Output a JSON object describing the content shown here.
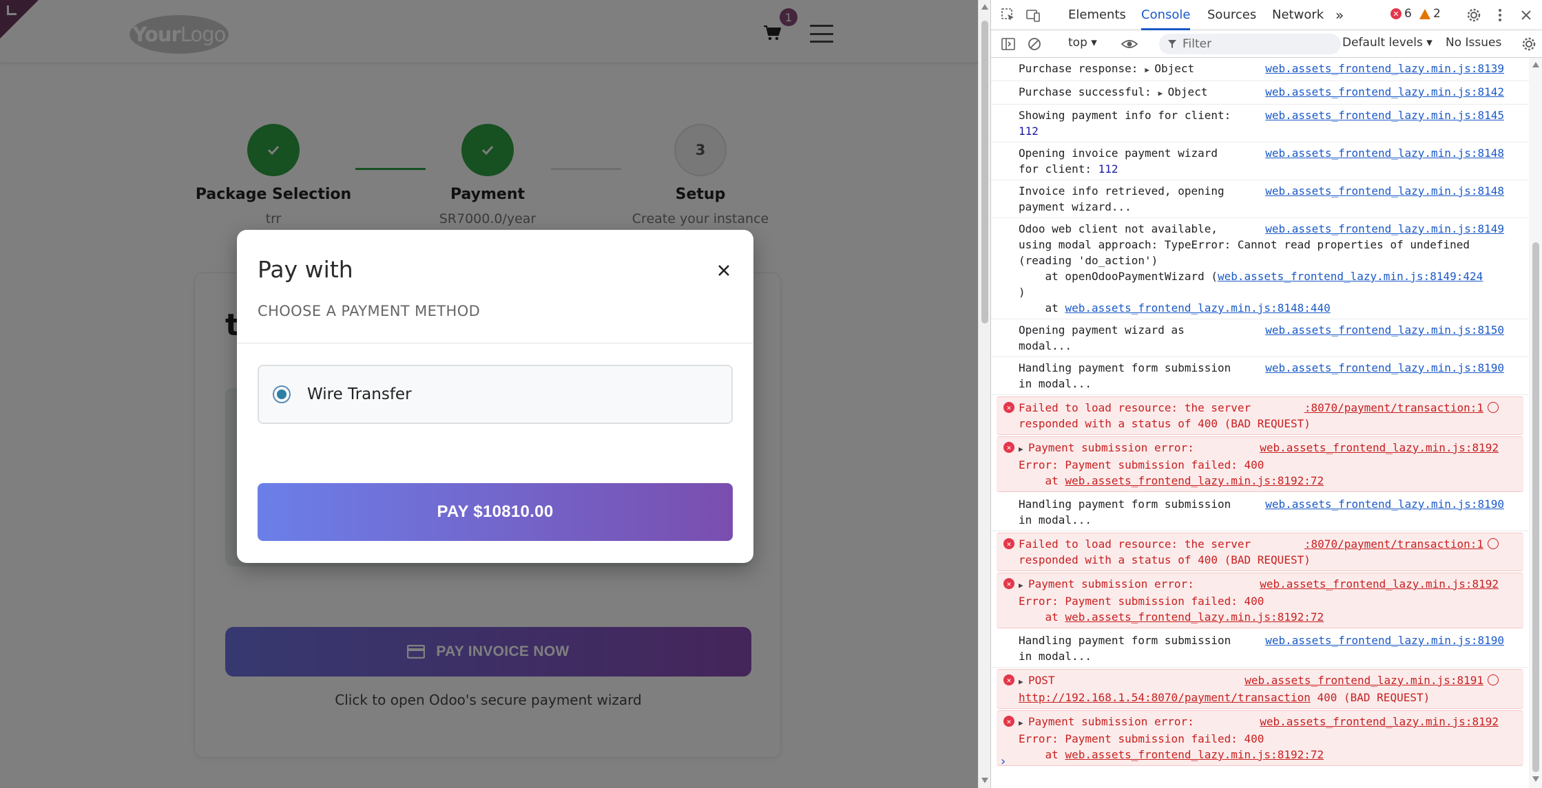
{
  "site": {
    "logo_bold": "Your",
    "logo_thin": "Logo",
    "cart_count": "1"
  },
  "steps": [
    {
      "title": "Package Selection",
      "sub": "trr",
      "state": "done"
    },
    {
      "title": "Payment",
      "sub": "SR7000.0/year",
      "state": "done"
    },
    {
      "title": "Setup",
      "sub": "Create your instance",
      "state": "todo",
      "number": "3"
    }
  ],
  "card": {
    "heading_partial": "t",
    "pay_invoice_label": "PAY INVOICE NOW",
    "hint": "Click to open Odoo's secure payment wizard"
  },
  "modal": {
    "title": "Pay with",
    "subtitle": "CHOOSE A PAYMENT METHOD",
    "method_label": "Wire Transfer",
    "pay_label": "PAY $10810.00"
  },
  "colors": {
    "step_done": "#2ea043",
    "cart_badge": "#8a4b78",
    "error_text": "#c71f1f",
    "link_blue": "#1a59c7"
  },
  "devtools": {
    "tabs": [
      "Elements",
      "Console",
      "Sources",
      "Network"
    ],
    "active_tab": "Console",
    "error_count": "6",
    "warning_count": "2",
    "context": "top",
    "filter_placeholder": "Filter",
    "levels": "Default levels",
    "issues": "No Issues",
    "messages": [
      {
        "type": "log",
        "text": "Purchase response:",
        "obj": "Object",
        "src": "web.assets_frontend_lazy.min.js:8139"
      },
      {
        "type": "log",
        "text": "Purchase successful:",
        "obj": "Object",
        "src": "web.assets_frontend_lazy.min.js:8142"
      },
      {
        "type": "log",
        "text": "Showing payment info for client:",
        "num": "112",
        "src": "web.assets_frontend_lazy.min.js:8145"
      },
      {
        "type": "log",
        "text": "Opening invoice payment wizard",
        "text2": "for client:",
        "num": "112",
        "src": "web.assets_frontend_lazy.min.js:8148"
      },
      {
        "type": "log",
        "text": "Invoice info retrieved, opening",
        "text2": "payment wizard...",
        "src": "web.assets_frontend_lazy.min.js:8148"
      },
      {
        "type": "log",
        "text": "Odoo web client not available,",
        "text2": "using modal approach: TypeError: Cannot read properties of undefined",
        "text3": "(reading 'do_action')",
        "text4": "    at openOdooPaymentWizard (",
        "link4": "web.assets_frontend_lazy.min.js:8149:424",
        "text5": ")",
        "text6": "    at ",
        "link6": "web.assets_frontend_lazy.min.js:8148:440",
        "src": "web.assets_frontend_lazy.min.js:8149"
      },
      {
        "type": "log",
        "text": "Opening payment wizard as",
        "text2": "modal...",
        "src": "web.assets_frontend_lazy.min.js:8150"
      },
      {
        "type": "log",
        "text": "Handling payment form submission",
        "text2": "in modal...",
        "src": "web.assets_frontend_lazy.min.js:8190"
      },
      {
        "type": "error",
        "text": "Failed to load resource: the server",
        "text2": "responded with a status of 400 (BAD REQUEST)",
        "src": ":8070/payment/transaction:1"
      },
      {
        "type": "error",
        "tri": true,
        "text": "Payment submission error:",
        "text2": "Error: Payment submission failed: 400",
        "text3": "    at ",
        "link3": "web.assets_frontend_lazy.min.js:8192:72",
        "src": "web.assets_frontend_lazy.min.js:8192"
      },
      {
        "type": "log",
        "text": "Handling payment form submission",
        "text2": "in modal...",
        "src": "web.assets_frontend_lazy.min.js:8190"
      },
      {
        "type": "error",
        "text": "Failed to load resource: the server",
        "text2": "responded with a status of 400 (BAD REQUEST)",
        "src": ":8070/payment/transaction:1"
      },
      {
        "type": "error",
        "tri": true,
        "text": "Payment submission error:",
        "text2": "Error: Payment submission failed: 400",
        "text3": "    at ",
        "link3": "web.assets_frontend_lazy.min.js:8192:72",
        "src": "web.assets_frontend_lazy.min.js:8192"
      },
      {
        "type": "log",
        "text": "Handling payment form submission",
        "text2": "in modal...",
        "src": "web.assets_frontend_lazy.min.js:8190"
      },
      {
        "type": "error",
        "tri": true,
        "text": "POST",
        "link2": "http://192.168.1.54:8070/payment/transaction",
        "text2b": " 400 (BAD REQUEST)",
        "src": "web.assets_frontend_lazy.min.js:8191"
      },
      {
        "type": "error",
        "tri": true,
        "text": "Payment submission error:",
        "text2": "Error: Payment submission failed: 400",
        "text3": "    at ",
        "link3": "web.assets_frontend_lazy.min.js:8192:72",
        "src": "web.assets_frontend_lazy.min.js:8192"
      }
    ]
  }
}
